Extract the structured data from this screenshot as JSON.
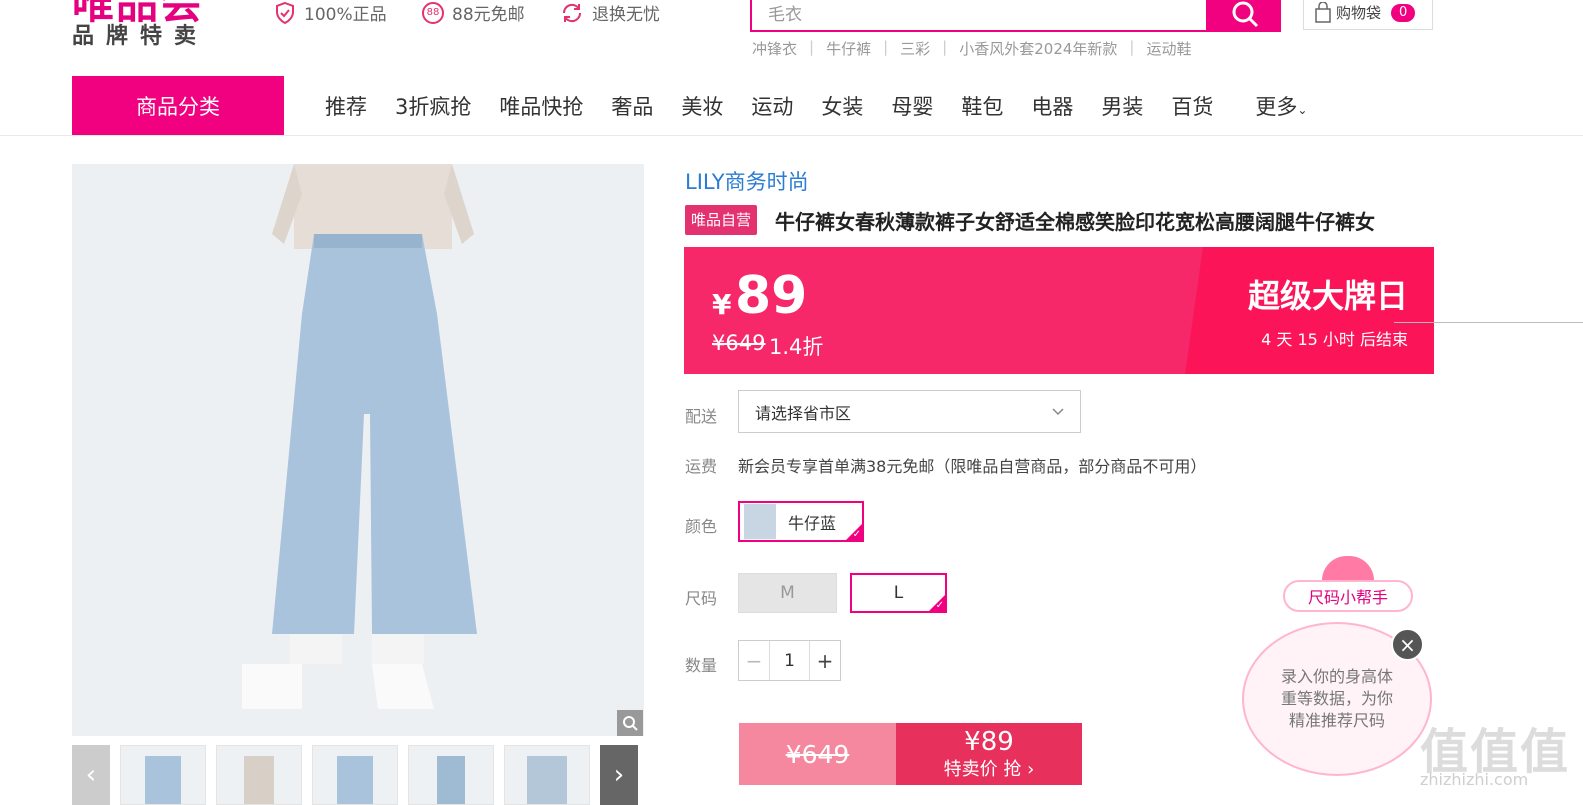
{
  "header": {
    "logo_text": "唯品会",
    "logo_subtitle": "品牌特卖",
    "promises": [
      {
        "icon": "shield-check-icon",
        "label": "100%正品"
      },
      {
        "icon": "free-shipping-88-icon",
        "badge": "88",
        "label": "88元免邮"
      },
      {
        "icon": "return-icon",
        "label": "退换无忧"
      }
    ],
    "search": {
      "value": "毛衣",
      "button_icon": "search-icon"
    },
    "cart": {
      "label": "购物袋",
      "count": "0"
    },
    "hot_words": [
      "冲锋衣",
      "牛仔裤",
      "三彩",
      "小香风外套2024年新款",
      "运动鞋"
    ]
  },
  "nav": {
    "category_button": "商品分类",
    "items": [
      "推荐",
      "3折疯抢",
      "唯品快抢",
      "奢品",
      "美妆",
      "运动",
      "女装",
      "母婴",
      "鞋包",
      "电器",
      "男装",
      "百货"
    ],
    "more": "更多"
  },
  "product": {
    "brand": "LILY商务时尚",
    "tag": "唯品自营",
    "title": "牛仔裤女春秋薄款裤子女舒适全棉感笑脸印花宽松高腰阔腿牛仔裤女",
    "price": {
      "currency": "¥",
      "value": "89",
      "original": "¥649",
      "discount": "1.4折",
      "event_name": "超级大牌日",
      "countdown": "4 天 15 小时 后结束"
    },
    "delivery": {
      "label": "配送",
      "placeholder": "请选择省市区"
    },
    "shipping": {
      "label": "运费",
      "text": "新会员专享首单满38元免邮（限唯品自营商品，部分商品不可用）"
    },
    "color": {
      "label": "颜色",
      "selected": "牛仔蓝"
    },
    "size": {
      "label": "尺码",
      "options": [
        {
          "label": "M",
          "state": "disabled"
        },
        {
          "label": "L",
          "state": "selected"
        }
      ]
    },
    "quantity": {
      "label": "数量",
      "value": "1",
      "minus": "−",
      "plus": "+"
    },
    "buy": {
      "original": "¥649",
      "price": "¥89",
      "label": "特卖价 抢 ›"
    }
  },
  "size_helper": {
    "tag": "尺码小帮手",
    "message": "录入你的身高体重等数据，为你精准推荐尺码",
    "close": "×"
  },
  "watermark": {
    "text": "值值值",
    "url": "zhizhizhi.com"
  },
  "colors": {
    "brand_pink": "#f10180",
    "price_band": "#f6286a",
    "buy_button": "#e8305c",
    "brand_link": "#2b7cd3"
  }
}
